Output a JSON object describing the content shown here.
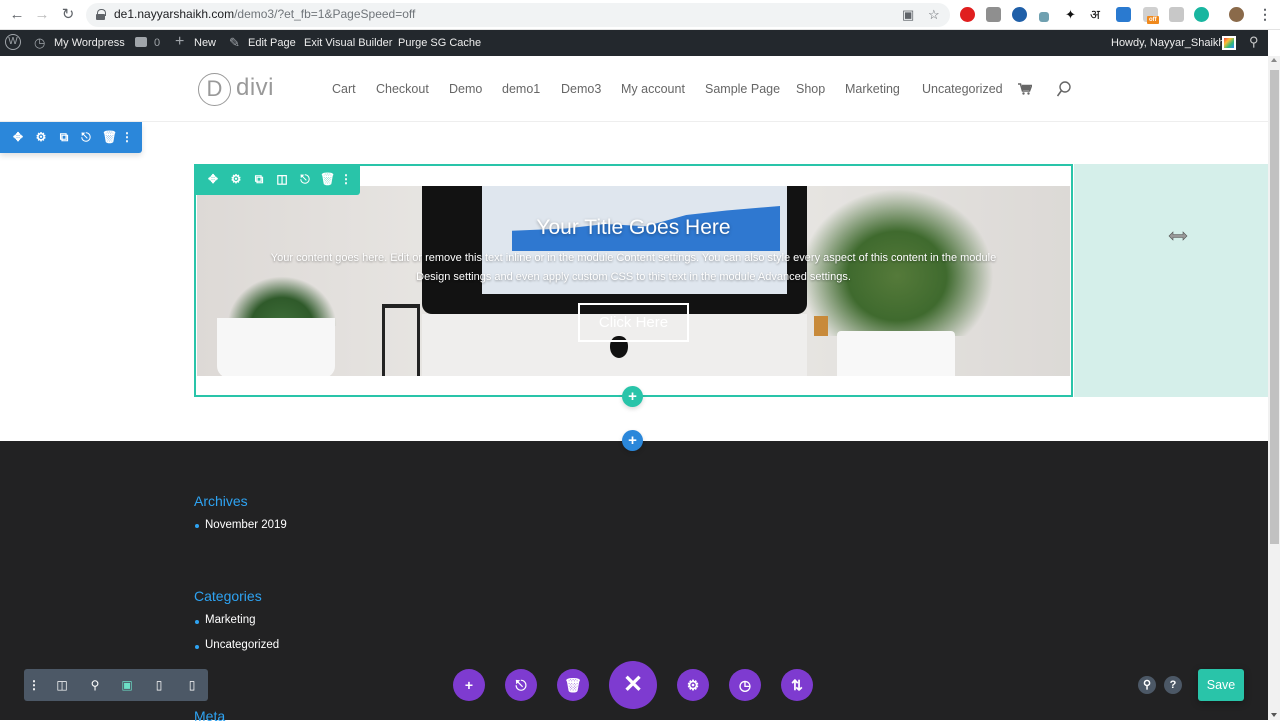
{
  "browser": {
    "url_domain": "de1.nayyarshaikh.com",
    "url_path": "/demo3/?et_fb=1&PageSpeed=off",
    "extensions": [
      {
        "name": "opera-extension",
        "color": "#e01f1f"
      },
      {
        "name": "fb-extension",
        "color": "#8f8f8f"
      },
      {
        "name": "compass-extension",
        "color": "#1f5fa8"
      },
      {
        "name": "eyedropper-extension",
        "color": "#6fa0b0"
      },
      {
        "name": "ninja-extension",
        "color": "#111111"
      },
      {
        "name": "hindi-extension",
        "color": "#111111"
      },
      {
        "name": "download-extension",
        "color": "#2a7ad0"
      },
      {
        "name": "pagespeed-off-extension",
        "color": "#b8b8b8"
      },
      {
        "name": "screenshot-extension",
        "color": "#c8c8c8"
      },
      {
        "name": "m-extension",
        "color": "#19b6a0"
      }
    ],
    "ext_badge": "off",
    "avatar_color": "#8a6a4a"
  },
  "wpbar": {
    "site_name": "My Wordpress",
    "comments_count": "0",
    "new_label": "New",
    "edit_page": "Edit Page",
    "exit_builder": "Exit Visual Builder",
    "purge_cache": "Purge SG Cache",
    "howdy": "Howdy, Nayyar_Shaikh"
  },
  "header": {
    "logo_letter": "D",
    "logo_text": "divi",
    "nav": [
      "Cart",
      "Checkout",
      "Demo",
      "demo1",
      "Demo3",
      "My account",
      "Sample Page",
      "Shop",
      "Marketing",
      "Uncategorized"
    ]
  },
  "hero": {
    "title": "Your Title Goes Here",
    "body": "Your content goes here. Edit or remove this text inline or in the module Content settings. You can also style every aspect of this content in the module Design settings and even apply custom CSS to this text in the module Advanced settings.",
    "button": "Click Here"
  },
  "footer": {
    "widgets": [
      {
        "title": "Archives",
        "items": [
          "November 2019"
        ]
      },
      {
        "title": "Categories",
        "items": [
          "Marketing",
          "Uncategorized"
        ]
      },
      {
        "title": "Meta",
        "items": []
      }
    ]
  },
  "builder": {
    "save_label": "Save",
    "help_label": "?",
    "colors": {
      "section": "#2b87da",
      "row": "#29c4a9",
      "purple": "#7e3bd0",
      "view_bar": "#4c5866"
    }
  }
}
